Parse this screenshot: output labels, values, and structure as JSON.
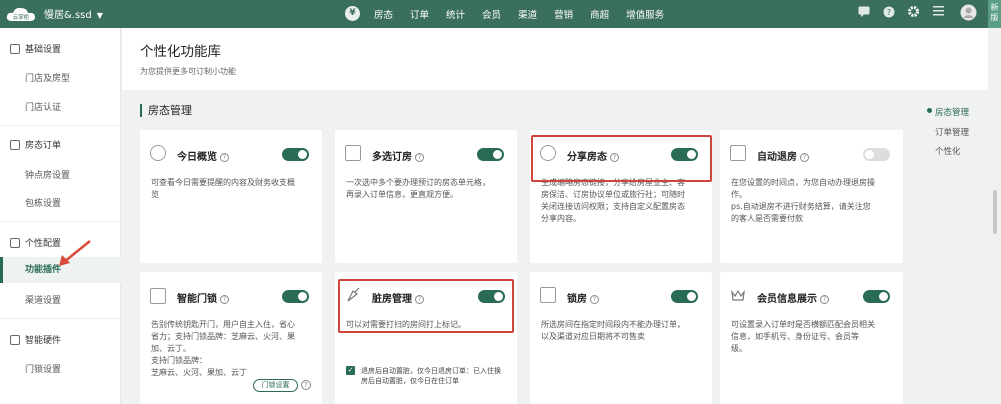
{
  "topbar": {
    "logo_text": "云掌柜",
    "store_name": "慢居&.ssd",
    "currency_symbol": "¥",
    "nav": [
      "房态",
      "订单",
      "统计",
      "会员",
      "渠道",
      "营销",
      "商超",
      "增值服务"
    ],
    "new_tag": "新版"
  },
  "sidebar": {
    "groups": [
      {
        "label": "基础设置",
        "items": [
          "门店及房型",
          "门店认证"
        ]
      },
      {
        "label": "房态订单",
        "items": [
          "钟点房设置",
          "包栋设置"
        ]
      },
      {
        "label": "个性配置",
        "items": [
          "功能插件",
          "渠道设置"
        ]
      },
      {
        "label": "智能硬件",
        "items": [
          "门锁设置"
        ]
      }
    ]
  },
  "header": {
    "title": "个性化功能库",
    "subtitle": "为您提供更多可订制小功能"
  },
  "section": {
    "title": "房态管理"
  },
  "cards": [
    {
      "name": "今日概览",
      "enabled": true,
      "desc": [
        "可查看今日需要提醒的内容及财务收支概",
        "览"
      ]
    },
    {
      "name": "多选订房",
      "enabled": true,
      "desc": [
        "一次选中多个要办理预订的房态单元格，",
        "再录入订单信息，更直观方便。"
      ]
    },
    {
      "name": "分享房态",
      "enabled": true,
      "desc": [
        "生成缩略房态链接，分享给房屋业主、客",
        "房保洁、订房协议单位或旅行社；可随时",
        "关闭连接访问权限；支持自定义配置房态",
        "分享内容。"
      ]
    },
    {
      "name": "自动退房",
      "enabled": false,
      "desc": [
        "在您设置的时间点，为您自动办理退房操",
        "作。",
        "ps.自动退房不进行财务结算，请关注您",
        "的客人是否需要付款"
      ]
    },
    {
      "name": "智能门锁",
      "enabled": true,
      "desc": [
        "告别传统钥匙开门，用户自主入住，省心",
        "省力；支持门锁品牌：芝麻云、火河、果",
        "加、云丁。",
        "支持门锁品牌：",
        "芝麻云、火河、果加、云丁"
      ],
      "button": "门锁设置"
    },
    {
      "name": "脏房管理",
      "enabled": true,
      "desc": [
        "可以对需要打扫的房间打上标记。"
      ],
      "option": "退房后自动置脏，仅今日退房订单：已入住换房后自动置脏，仅今日在住订单"
    },
    {
      "name": "锁房",
      "enabled": true,
      "desc": [
        "所选房间在指定时间段内不能办理订单，",
        "以及渠道对应日期将不可售卖"
      ]
    },
    {
      "name": "会员信息展示",
      "enabled": true,
      "desc": [
        "可设置录入订单时是否横额匹配会员相关",
        "信息，如手机号、身份证号、会员等",
        "级。"
      ]
    }
  ],
  "right_nav": [
    "房态管理",
    "订单管理",
    "个性化"
  ],
  "colors": {
    "brand": "#3a6e5f",
    "accent": "#2a6b58",
    "highlight": "#d0443b"
  }
}
